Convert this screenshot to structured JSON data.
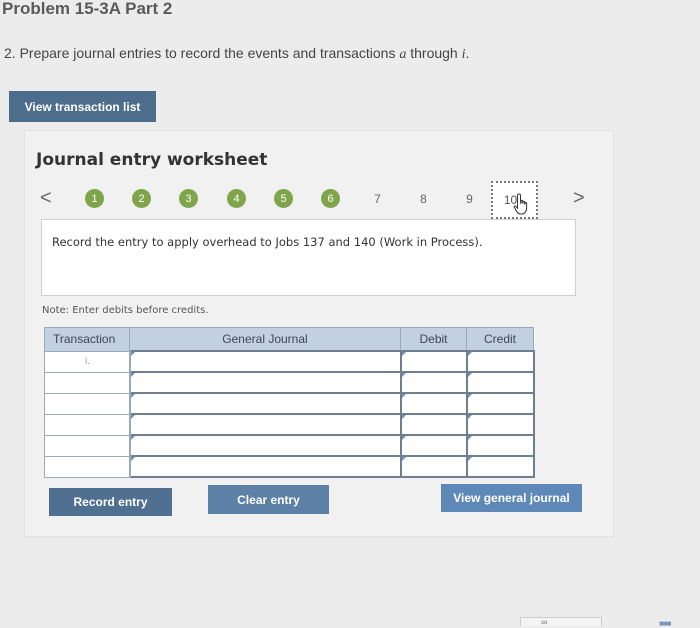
{
  "header": {
    "title": "Problem 15-3A Part 2",
    "instruction_prefix": "2. Prepare journal entries to record the events and transactions ",
    "instruction_a": "a",
    "instruction_middle": " through ",
    "instruction_i": "i",
    "instruction_suffix": "."
  },
  "buttons": {
    "view_transaction_list": "View transaction list",
    "record_entry": "Record entry",
    "clear_entry": "Clear entry",
    "view_general_journal": "View general journal"
  },
  "worksheet": {
    "title": "Journal entry worksheet",
    "prev_arrow": "<",
    "next_arrow": ">",
    "steps": [
      "1",
      "2",
      "3",
      "4",
      "5",
      "6",
      "7",
      "8",
      "9",
      "10"
    ],
    "completed_steps": 6,
    "current_step": "10",
    "description": "Record the entry to apply overhead to Jobs 137 and 140 (Work in Process).",
    "note": "Note: Enter debits before credits."
  },
  "journal_table": {
    "headers": [
      "Transaction",
      "General Journal",
      "Debit",
      "Credit"
    ],
    "rows": [
      {
        "transaction": "i.",
        "account": "",
        "debit": "",
        "credit": ""
      },
      {
        "transaction": "",
        "account": "",
        "debit": "",
        "credit": ""
      },
      {
        "transaction": "",
        "account": "",
        "debit": "",
        "credit": ""
      },
      {
        "transaction": "",
        "account": "",
        "debit": "",
        "credit": ""
      },
      {
        "transaction": "",
        "account": "",
        "debit": "",
        "credit": ""
      },
      {
        "transaction": "",
        "account": "",
        "debit": "",
        "credit": ""
      }
    ]
  },
  "colors": {
    "completed_step": "#7fa54a",
    "button_dark": "#4d6d8d",
    "button_blue": "#5d88b8",
    "table_header": "#c2d0df"
  },
  "icons": {
    "pointer": "hand-pointer-icon",
    "link": "link-icon",
    "grid": "grid-icon"
  }
}
